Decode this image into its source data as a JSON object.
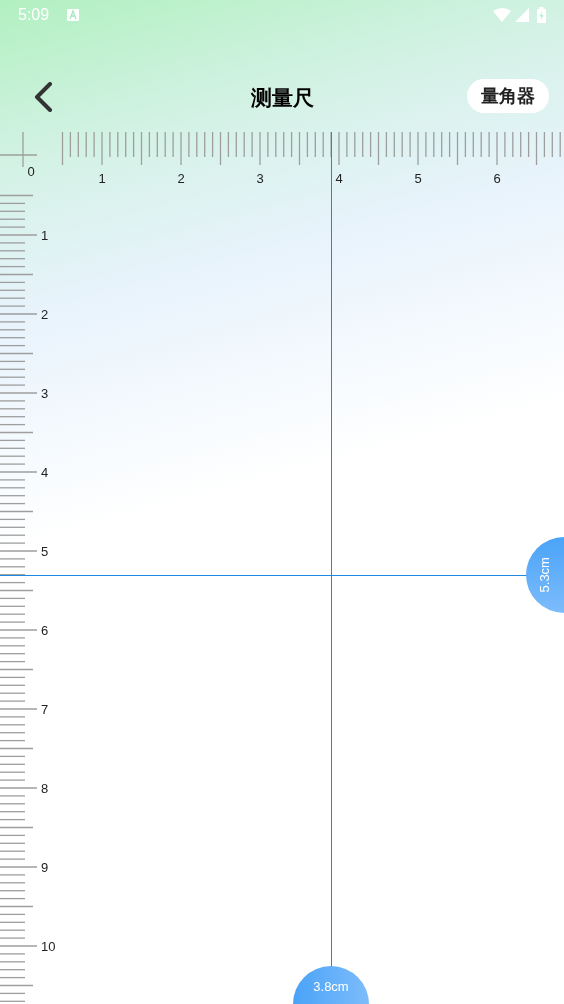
{
  "status_bar": {
    "time": "5:09"
  },
  "header": {
    "title": "测量尺",
    "button": "量角器"
  },
  "horizontal_ruler": {
    "labels": [
      "0",
      "1",
      "2",
      "3",
      "4",
      "5",
      "6"
    ]
  },
  "vertical_ruler": {
    "labels": [
      "1",
      "2",
      "3",
      "4",
      "5",
      "6",
      "7",
      "8",
      "9",
      "10"
    ]
  },
  "readings": {
    "x": "3.8cm",
    "y": "5.3cm"
  }
}
